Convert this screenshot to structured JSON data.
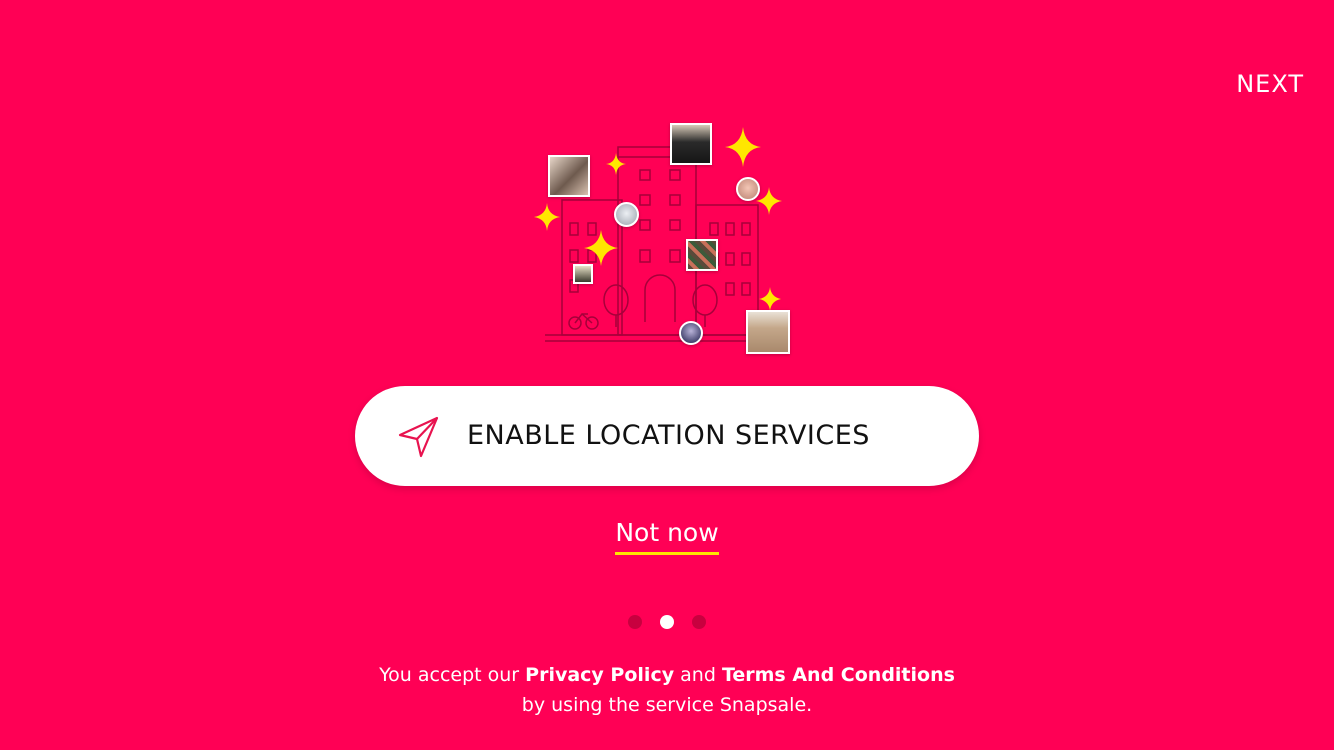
{
  "header": {
    "next_label": "NEXT"
  },
  "illustration": {
    "icon": "city-buildings-with-product-photos",
    "sparkle_color": "#FFE600"
  },
  "enable_button": {
    "label": "ENABLE LOCATION SERVICES",
    "icon": "location-arrow-icon"
  },
  "not_now": {
    "label": "Not now"
  },
  "pagination": {
    "total": 3,
    "active_index": 1
  },
  "legal": {
    "prefix": "You accept our",
    "privacy_policy": "Privacy Policy",
    "and": "and",
    "terms": "Terms And Conditions",
    "suffix": "by using the service Snapsale."
  },
  "colors": {
    "background": "#FF0055",
    "accent": "#FFE600",
    "button": "#FFFFFF"
  }
}
